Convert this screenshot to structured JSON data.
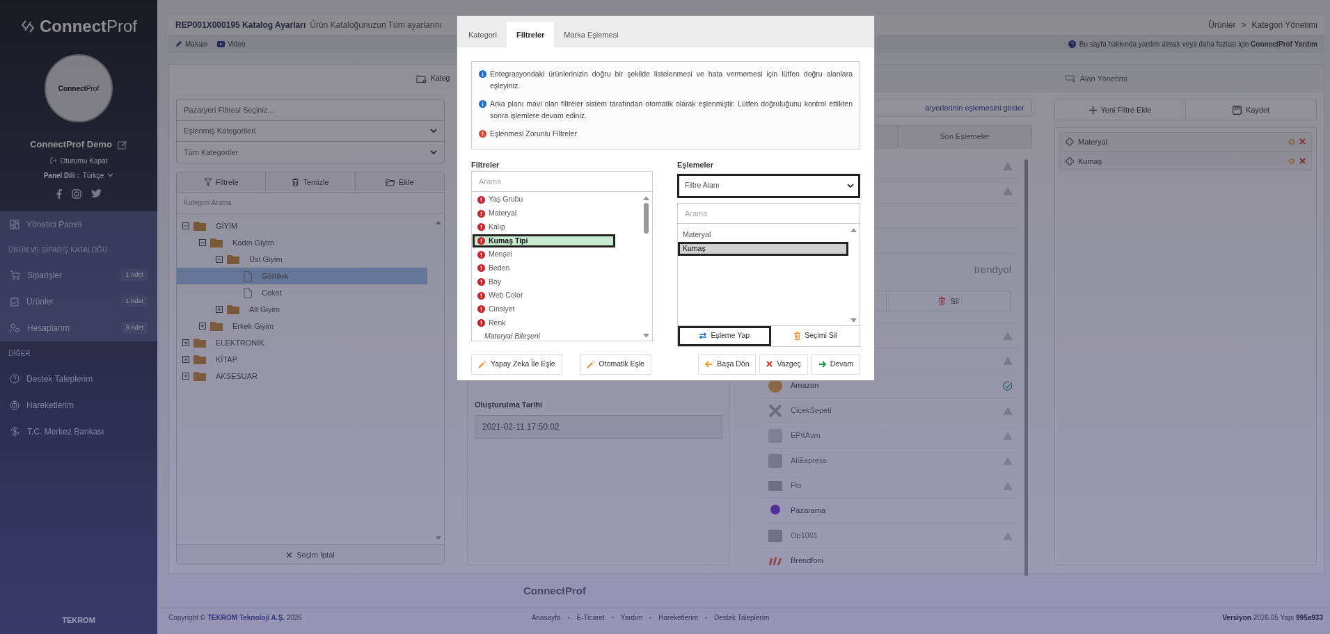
{
  "sidebar": {
    "logo": "**Connect**Prof",
    "avatar_logo": "**Connect**Prof",
    "user_name": "ConnectProf Demo",
    "logout": "Oturumu Kapat",
    "language_label": "Panel Dili :",
    "language": "Türkçe",
    "sections": [
      {
        "shaded": true,
        "items": [
          {
            "label": "Yönetici Paneli"
          }
        ]
      },
      {
        "title": "ÜRÜN VE SİPARİŞ KATALOĞU",
        "shaded": true,
        "items": [
          {
            "label": "Siparişler",
            "badge": "1 Adet"
          },
          {
            "label": "Ürünler",
            "badge": "1 Adet"
          },
          {
            "label": "Hesaplarım",
            "badge": "8 Adet"
          }
        ]
      },
      {
        "title": "DİĞER",
        "shaded": false,
        "items": [
          {
            "label": "Destek Taleplerim"
          },
          {
            "label": "Hareketlerim"
          },
          {
            "label": "T.C. Merkez Bankası"
          }
        ]
      }
    ],
    "company": "TEKROM"
  },
  "header": {
    "title": "REP001X000195 Katalog Ayarları",
    "subtitle": "Ürün Kataloğunuzun Tüm ayarlarını",
    "breadcrumb": [
      "Ürünler",
      "Kategori Yönetimi"
    ],
    "separator": ">",
    "links": [
      "Makale",
      "Video"
    ],
    "help_text": "Bu sayfa hakkında yardım almak veya daha fazlası için",
    "help_link": "ConnectProf Yardım"
  },
  "main_tabs": [
    {
      "label": "Kateg",
      "selected": true
    },
    {
      "label": "Alan Yönetimi",
      "selected": false
    }
  ],
  "left_panel": {
    "marketplace_filter_placeholder": "Pazaryeri Filtresi Seçiniz...",
    "selects": [
      "Eşlenmiş Kategorileri",
      "Tüm Kategoriler"
    ],
    "toolbar": [
      "Filtrele",
      "Temizle",
      "Ekle"
    ],
    "search_placeholder": "Kategori Arama",
    "tree": [
      {
        "label": "GİYİM",
        "kind": "folder",
        "expanded": true,
        "selected": false,
        "children": [
          {
            "label": "Kadın Giyim",
            "kind": "folder",
            "expanded": true,
            "selected": false,
            "children": [
              {
                "label": "Üst Giyim",
                "kind": "folder",
                "expanded": true,
                "selected": false,
                "children": [
                  {
                    "label": "Gömlek",
                    "kind": "file",
                    "selected": true
                  },
                  {
                    "label": "Ceket",
                    "kind": "file",
                    "selected": false
                  }
                ]
              },
              {
                "label": "Alt Giyim",
                "kind": "folder",
                "expanded": false,
                "selected": false
              }
            ]
          },
          {
            "label": "Erkek Giyim",
            "kind": "folder",
            "expanded": false,
            "selected": false
          }
        ]
      },
      {
        "label": "ELEKTRONİK",
        "kind": "folder",
        "expanded": false,
        "selected": false
      },
      {
        "label": "KİTAP",
        "kind": "folder",
        "expanded": false,
        "selected": false
      },
      {
        "label": "AKSESUAR",
        "kind": "folder",
        "expanded": false,
        "selected": false
      }
    ],
    "cancel_button": "Seçim İptal"
  },
  "middle_panel": {
    "created_label": "Oluşturulma Tarihi",
    "created_value": "2021-02-11 17:50:02"
  },
  "market_panel": {
    "show_mappings_button": "aryerlerinin eşlemesini göster",
    "tabs": [
      {
        "label": "Son Eşlemeler",
        "selected": false
      }
    ],
    "rows": [
      {
        "kind": "row",
        "warning": true,
        "mapped": false
      },
      {
        "kind": "row",
        "warning": true,
        "mapped": false
      },
      {
        "kind": "row",
        "warning": false,
        "mapped": false
      },
      {
        "kind": "row",
        "warning": false,
        "mapped": false
      },
      {
        "kind": "brand_card",
        "brand": "trendyol",
        "delete_button": "Sil"
      },
      {
        "kind": "row",
        "warning": true,
        "mapped": false
      },
      {
        "kind": "row",
        "warning": true,
        "mapped": false
      },
      {
        "kind": "row",
        "name": "Amazon",
        "warning": false,
        "mapped": true
      },
      {
        "kind": "row",
        "name": "ÇiçekSepeti",
        "warning": true,
        "mapped": false
      },
      {
        "kind": "row",
        "name": "EPttAvm",
        "warning": true,
        "mapped": false
      },
      {
        "kind": "row",
        "name": "AliExpress",
        "warning": true,
        "mapped": false
      },
      {
        "kind": "row",
        "name": "Flo",
        "warning": true,
        "mapped": false
      },
      {
        "kind": "row",
        "name": "Pazarama",
        "warning": false,
        "mapped": false
      },
      {
        "kind": "row",
        "name": "Op1001",
        "warning": true,
        "mapped": false
      },
      {
        "kind": "row",
        "name": "Brendfoni",
        "warning": false,
        "mapped": false
      }
    ]
  },
  "right_panel": {
    "add_button": "Yeni Filtre Ekle",
    "save_button": "Kaydet",
    "filters": [
      {
        "label": "Materyal"
      },
      {
        "label": "Kumaş"
      }
    ]
  },
  "modal": {
    "tabs": [
      {
        "label": "Kategori",
        "selected": false
      },
      {
        "label": "Filtreler",
        "selected": true
      },
      {
        "label": "Marka Eşlemesi",
        "selected": false
      }
    ],
    "info": [
      {
        "kind": "info",
        "text": "Entegrasyondaki ürünlerinizin doğru bir şekilde listelenmesi ve hata vermemesi için lütfen doğru alanlara eşleyiniz."
      },
      {
        "kind": "info",
        "text": "Arka planı mavi olan filtreler sistem tarafından otomatik olarak eşlenmiştir. Lütfen doğruluğunu kontrol ettikten sonra işlemlere devam ediniz."
      },
      {
        "kind": "required",
        "text": "Eşlenmesi Zorunlu Filtreler"
      }
    ],
    "filters_label": "Filtreler",
    "filters_search_placeholder": "Arama",
    "filters": [
      {
        "kind": "required",
        "label": "Yaş Grubu",
        "selected": false
      },
      {
        "kind": "required",
        "label": "Materyal",
        "selected": false
      },
      {
        "kind": "required",
        "label": "Kalıp",
        "selected": false
      },
      {
        "kind": "required",
        "label": "Kumaş Tipi",
        "selected": true
      },
      {
        "kind": "required",
        "label": "Menşei",
        "selected": false
      },
      {
        "kind": "required",
        "label": "Beden",
        "selected": false
      },
      {
        "kind": "required",
        "label": "Boy",
        "selected": false
      },
      {
        "kind": "required",
        "label": "Web Color",
        "selected": false
      },
      {
        "kind": "required",
        "label": "Cinsiyet",
        "selected": false
      },
      {
        "kind": "required",
        "label": "Renk",
        "selected": false
      },
      {
        "kind": "group",
        "label": "Materyal Bileşeni",
        "selected": false
      }
    ],
    "mappings_label": "Eşlemeler",
    "mapping_select": {
      "value": "Filtre Alanı",
      "highlighted": true
    },
    "mappings_search_placeholder": "Arama",
    "mappings": [
      {
        "label": "Materyal",
        "selected": false
      },
      {
        "label": "Kumaş",
        "selected": true
      }
    ],
    "map_actions": [
      {
        "label": "Eşleme Yap",
        "highlighted": true
      },
      {
        "label": "Seçimi Sil",
        "highlighted": false
      }
    ],
    "match_buttons": [
      "Yapay Zeka İle Eşle",
      "Otomatik Eşle"
    ],
    "nav_buttons": [
      "Başa Dön",
      "Vazgeç",
      "Devam"
    ]
  },
  "footer": {
    "brand": "ConnectProf",
    "copyright": "Copyright © **TEKROM Teknoloji A.Ş.** 2026",
    "links": [
      "Anasayfa",
      "E-Ticaret",
      "Yardım",
      "Hareketlerim",
      "Destek Taleplerim"
    ],
    "version": "**Versiyon** 2026.05 Yapı **995a933**"
  }
}
